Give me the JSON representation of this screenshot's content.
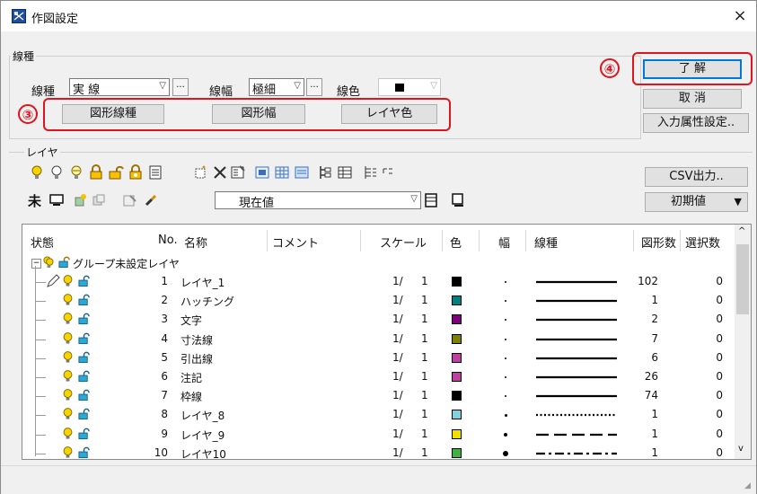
{
  "window": {
    "title": "作図設定",
    "close_glyph": "×"
  },
  "linetype_group": {
    "label": "線種",
    "linetype_label": "線種",
    "linetype_value": "実 線",
    "width_label": "線幅",
    "width_value": "極細",
    "color_label": "線色",
    "dots": "...",
    "buttons": {
      "shape_linetype": "図形線種",
      "shape_width": "図形幅",
      "layer_color": "レイヤ色"
    }
  },
  "right_buttons": {
    "ok": "了 解",
    "cancel": "取 消",
    "input_attr": "入力属性設定..",
    "csv": "CSV出力..",
    "initial": "初期値"
  },
  "annotations": {
    "three": "③",
    "four": "④"
  },
  "layer_group": {
    "label": "レイヤ",
    "unassigned": "未",
    "current_value": "現在値"
  },
  "table": {
    "headers": {
      "status": "状態",
      "no": "No.",
      "name": "名称",
      "comment": "コメント",
      "scale": "スケール",
      "color": "色",
      "width": "幅",
      "linetype": "線種",
      "shapes": "図形数",
      "selected": "選択数"
    },
    "group_name": "グループ未設定レイヤ",
    "rows": [
      {
        "no": "1",
        "name": "レイヤ_1",
        "scale": "1/",
        "scale2": "1",
        "color": "#000000",
        "width": "dot",
        "linestyle": "solid",
        "shapes": "102",
        "selected": "0"
      },
      {
        "no": "2",
        "name": "ハッチング",
        "scale": "1/",
        "scale2": "1",
        "color": "#008080",
        "width": "dot",
        "linestyle": "solid",
        "shapes": "1",
        "selected": "0"
      },
      {
        "no": "3",
        "name": "文字",
        "scale": "1/",
        "scale2": "1",
        "color": "#800080",
        "width": "dot",
        "linestyle": "solid",
        "shapes": "2",
        "selected": "0"
      },
      {
        "no": "4",
        "name": "寸法線",
        "scale": "1/",
        "scale2": "1",
        "color": "#808000",
        "width": "dot",
        "linestyle": "solid",
        "shapes": "7",
        "selected": "0"
      },
      {
        "no": "5",
        "name": "引出線",
        "scale": "1/",
        "scale2": "1",
        "color": "#c040a0",
        "width": "dot",
        "linestyle": "solid",
        "shapes": "6",
        "selected": "0"
      },
      {
        "no": "6",
        "name": "注記",
        "scale": "1/",
        "scale2": "1",
        "color": "#c040a0",
        "width": "dot",
        "linestyle": "solid",
        "shapes": "26",
        "selected": "0"
      },
      {
        "no": "7",
        "name": "枠線",
        "scale": "1/",
        "scale2": "1",
        "color": "#000000",
        "width": "dot",
        "linestyle": "solid",
        "shapes": "74",
        "selected": "0"
      },
      {
        "no": "8",
        "name": "レイヤ_8",
        "scale": "1/",
        "scale2": "1",
        "color": "#80d0e0",
        "width": "small",
        "linestyle": "dotted",
        "shapes": "1",
        "selected": "0"
      },
      {
        "no": "9",
        "name": "レイヤ_9",
        "scale": "1/",
        "scale2": "1",
        "color": "#f0e000",
        "width": "medium",
        "linestyle": "dashed",
        "shapes": "1",
        "selected": "0"
      },
      {
        "no": "10",
        "name": "レイヤ10",
        "scale": "1/",
        "scale2": "1",
        "color": "#40b040",
        "width": "large",
        "linestyle": "dashdot",
        "shapes": "1",
        "selected": "0"
      }
    ]
  },
  "colors": {
    "highlight": "#e0141e",
    "default_btn": "#0078d7"
  }
}
